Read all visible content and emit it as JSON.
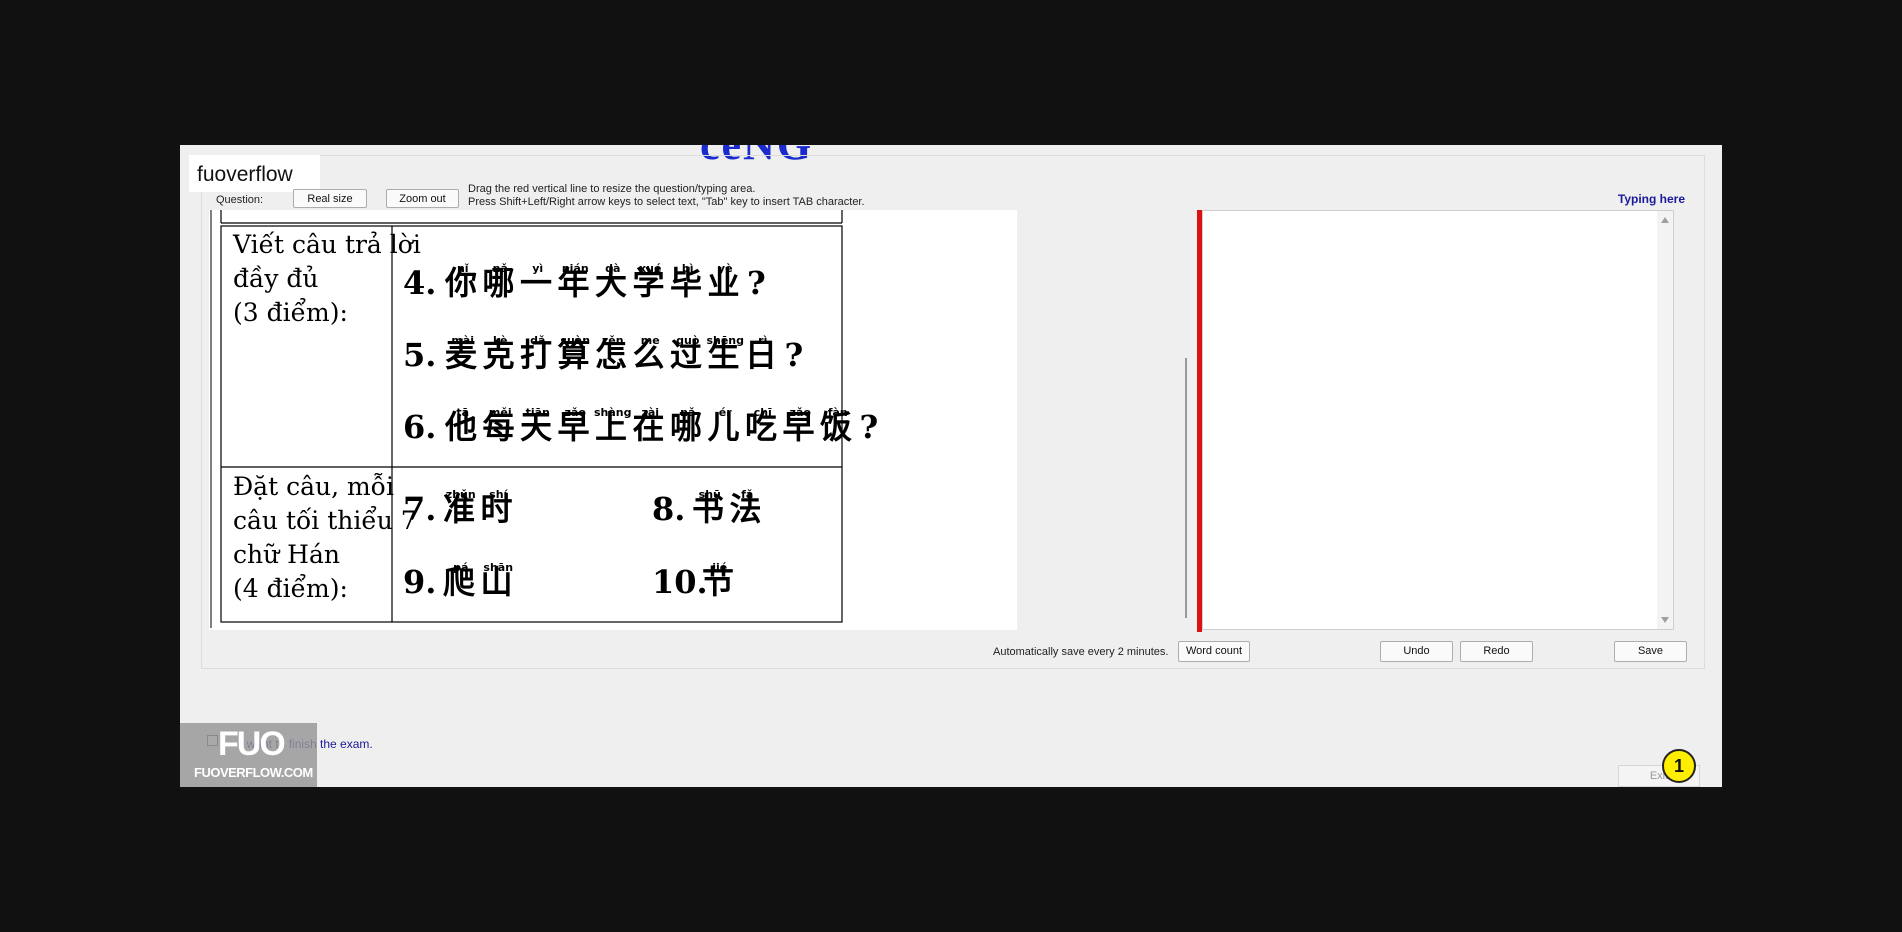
{
  "window": {
    "title_peek": "ceNG",
    "logo_text": "fuoverflow"
  },
  "toolbar": {
    "question_label": "Question:",
    "real_size": "Real size",
    "zoom_out": "Zoom out",
    "hint_line1": "Drag the red vertical line to resize the question/typing area.",
    "hint_line2": "Press Shift+Left/Right arrow keys to select text, \"Tab\" key to insert TAB character.",
    "typing_here": "Typing here"
  },
  "question": {
    "rows": [
      {
        "prompt": [
          "Viết câu trả lời",
          "đầy đủ",
          "(3 điểm):"
        ],
        "sentences": [
          {
            "num": "4.",
            "chars": [
              "你",
              "哪",
              "一",
              "年",
              "大",
              "学",
              "毕",
              "业"
            ],
            "pinyin": [
              "nǐ",
              "nǎ",
              "yì",
              "nián",
              "dà",
              "xué",
              "bì",
              "yè"
            ],
            "end": "?"
          },
          {
            "num": "5.",
            "chars": [
              "麦",
              "克",
              "打",
              "算",
              "怎",
              "么",
              "过",
              "生",
              "日"
            ],
            "pinyin": [
              "mài",
              "kè",
              "dǎ",
              "suàn",
              "zěn",
              "me",
              "guò",
              "shēng",
              "rì"
            ],
            "end": "?"
          },
          {
            "num": "6.",
            "chars": [
              "他",
              "每",
              "天",
              "早",
              "上",
              "在",
              "哪",
              "儿",
              "吃",
              "早",
              "饭"
            ],
            "pinyin": [
              "tā",
              "měi",
              "tiān",
              "zǎo",
              "shàng",
              "zài",
              "nǎ",
              "ér",
              "chī",
              "zǎo",
              "fàn"
            ],
            "end": "?"
          }
        ]
      },
      {
        "prompt": [
          "Đặt câu, mỗi",
          "câu tối thiểu 7",
          "chữ Hán",
          "(4 điểm):"
        ],
        "words": [
          {
            "num": "7.",
            "chars": [
              "准",
              "时"
            ],
            "pinyin": [
              "zhǔn",
              "shí"
            ]
          },
          {
            "num": "8.",
            "chars": [
              "书",
              "法"
            ],
            "pinyin": [
              "shū",
              "fǎ"
            ]
          },
          {
            "num": "9.",
            "chars": [
              "爬",
              "山"
            ],
            "pinyin": [
              "pá",
              "shān"
            ]
          },
          {
            "num": "10.",
            "chars": [
              "节"
            ],
            "pinyin": [
              "jié"
            ]
          }
        ]
      }
    ]
  },
  "footer": {
    "autosave": "Automatically save every 2 minutes.",
    "word_count": "Word count",
    "undo": "Undo",
    "redo": "Redo",
    "save": "Save"
  },
  "watermark": {
    "big": "FUO",
    "small": "FUOVERFLOW.COM"
  },
  "finish": {
    "label": "I want to finish the exam.",
    "exit": "Exit",
    "badge": "1"
  }
}
